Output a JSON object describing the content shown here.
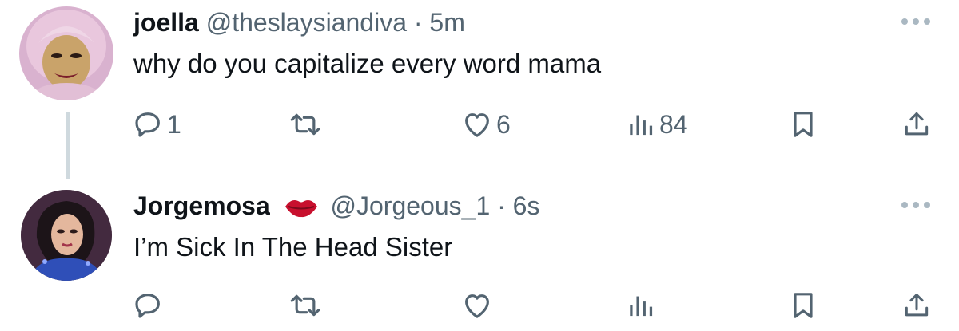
{
  "tweets": [
    {
      "name": "joella",
      "handle": "@theslaysiandiva",
      "separator": "·",
      "time": "5m",
      "text": "why do you capitalize every word mama",
      "actions": {
        "replies": "1",
        "reposts": "",
        "likes": "6",
        "views": "84"
      }
    },
    {
      "name": "Jorgemosa",
      "handle": "@Jorgeous_1",
      "separator": "·",
      "time": "6s",
      "text": "I’m Sick In The Head Sister",
      "actions": {
        "replies": "",
        "reposts": "",
        "likes": "",
        "views": ""
      }
    }
  ],
  "icons": {
    "more": "more-icon",
    "reply": "reply-icon",
    "repost": "repost-icon",
    "like": "heart-icon",
    "views": "views-icon",
    "bookmark": "bookmark-icon",
    "share": "share-icon",
    "badge": "lips-emoji-icon"
  },
  "colors": {
    "text": "#0f1419",
    "secondary": "#536471",
    "thread_line": "#cfd9de",
    "lips": "#c8102e"
  }
}
